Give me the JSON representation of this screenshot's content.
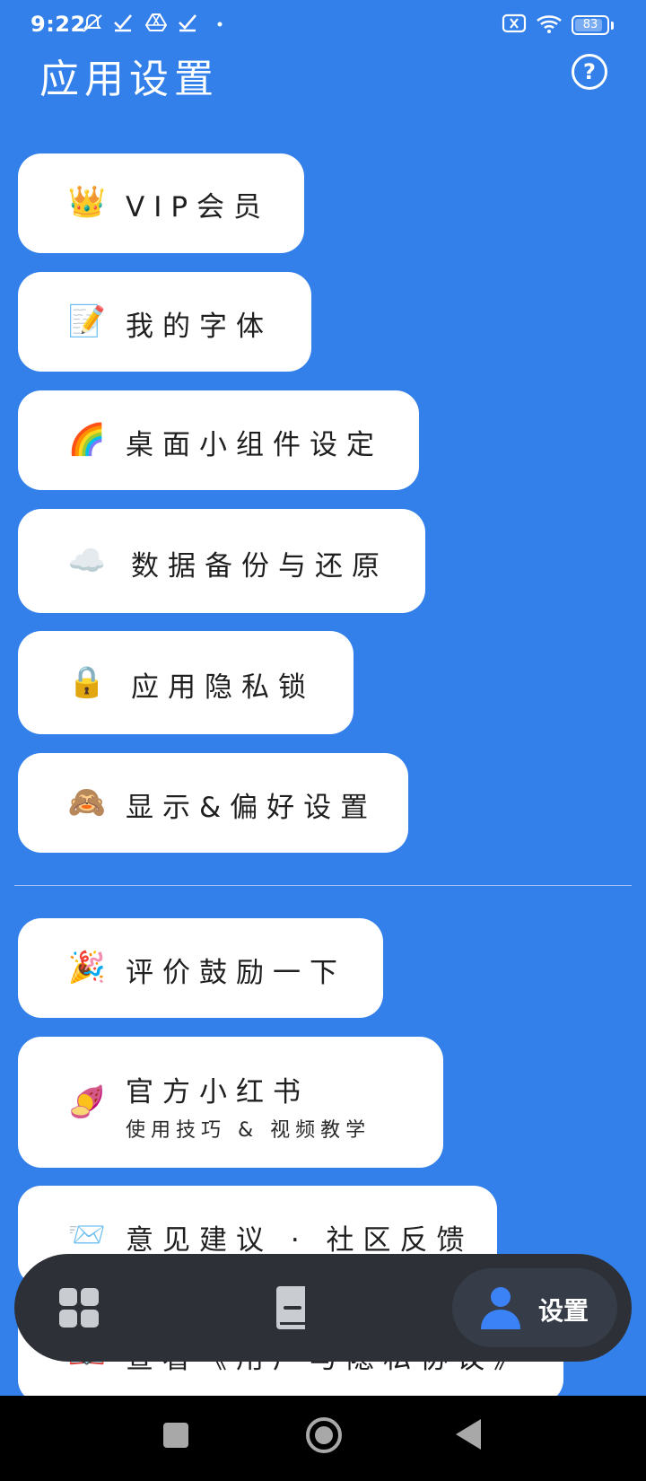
{
  "status_bar": {
    "time": "9:22",
    "battery": "83"
  },
  "header": {
    "title": "应用设置",
    "help_glyph": "?"
  },
  "menu": [
    {
      "icon": "👑",
      "label": "VIP会员"
    },
    {
      "icon": "📝",
      "label": "我的字体"
    },
    {
      "icon": "🌈",
      "label": "桌面小组件设定"
    },
    {
      "icon": "☁️",
      "label": "数据备份与还原"
    },
    {
      "icon": "🔒",
      "label": "应用隐私锁"
    },
    {
      "icon": "🙈",
      "label": "显示&偏好设置"
    },
    {
      "icon": "🎉",
      "label": "评价鼓励一下"
    },
    {
      "icon": "🍠",
      "label": "官方小红书",
      "sub": "使用技巧 & 视频教学"
    },
    {
      "icon": "📨",
      "label": "意见建议 · 社区反馈"
    },
    {
      "icon": "📖",
      "label": "查看《用户与隐私协议》"
    }
  ],
  "tabbar": {
    "tabs": [
      {
        "name": "grid",
        "icon": "grid-icon"
      },
      {
        "name": "book",
        "icon": "book-icon"
      },
      {
        "name": "settings",
        "icon": "person-icon",
        "label": "设置",
        "active": true
      }
    ]
  },
  "colors": {
    "background": "#3380ea",
    "card": "#ffffff",
    "tabbar": "#2d3137",
    "active_tab": "#363d48",
    "accent": "#3b82f6"
  }
}
